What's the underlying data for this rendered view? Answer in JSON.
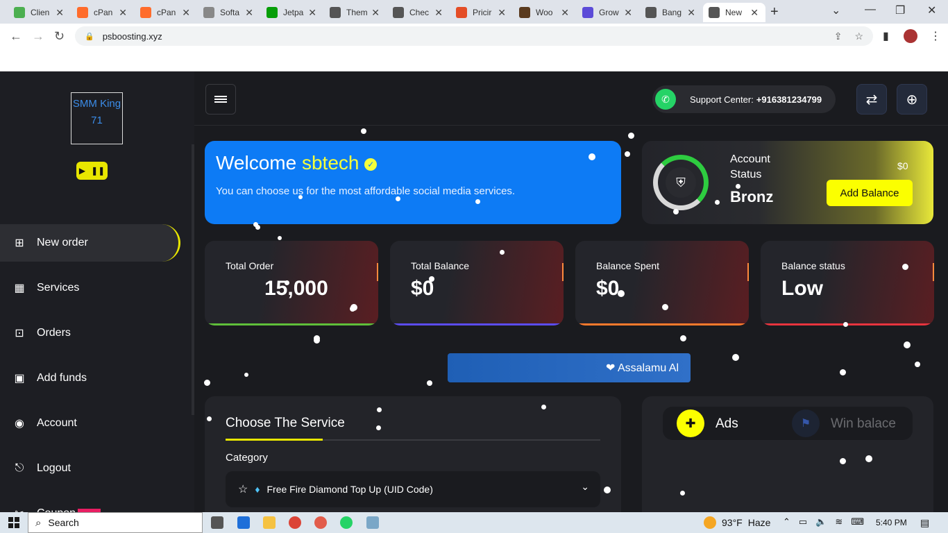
{
  "browser": {
    "tabs": [
      {
        "label": "Clien",
        "icon": "cpanel-client-icon",
        "color": "#4caf50"
      },
      {
        "label": "cPan",
        "icon": "cpanel-icon",
        "color": "#ff6c2c"
      },
      {
        "label": "cPan",
        "icon": "cpanel-icon",
        "color": "#ff6c2c"
      },
      {
        "label": "Softa",
        "icon": "softaculous-icon",
        "color": "#888888"
      },
      {
        "label": "Jetpa",
        "icon": "jetpack-icon",
        "color": "#069e08"
      },
      {
        "label": "Them",
        "icon": "globe-icon",
        "color": "#555555"
      },
      {
        "label": "Chec",
        "icon": "globe-icon",
        "color": "#555555"
      },
      {
        "label": "Pricir",
        "icon": "pricing-icon",
        "color": "#e44d26"
      },
      {
        "label": "Woo",
        "icon": "woo-icon",
        "color": "#5a3a1e"
      },
      {
        "label": "Grow",
        "icon": "grow-icon",
        "color": "#5c4bd8"
      },
      {
        "label": "Bang",
        "icon": "globe-icon",
        "color": "#555555"
      },
      {
        "label": "New",
        "icon": "globe-icon",
        "color": "#555555"
      }
    ],
    "url": "psboosting.xyz"
  },
  "sidebar": {
    "logo_alt": "SMM King 71",
    "items": [
      {
        "label": "New order",
        "icon": "plus-square-icon"
      },
      {
        "label": "Services",
        "icon": "grid-icon"
      },
      {
        "label": "Orders",
        "icon": "bag-icon"
      },
      {
        "label": "Add funds",
        "icon": "wallet-icon"
      },
      {
        "label": "Account",
        "icon": "user-circle-icon"
      },
      {
        "label": "Logout",
        "icon": "logout-icon"
      },
      {
        "label": "Coupon",
        "icon": "coupon-icon"
      }
    ]
  },
  "topbar": {
    "support_label": "Support Center:",
    "support_phone": "+916381234799"
  },
  "welcome": {
    "greeting": "Welcome",
    "username": "sbtech",
    "subtitle": "You can choose us for the most affordable social media services."
  },
  "account": {
    "label": "Account Status",
    "level": "Bronz",
    "add_balance": "Add Balance",
    "tag": "$0"
  },
  "stats": [
    {
      "label": "Total Order",
      "value": "15,000",
      "bar_color": "#5fbf3a"
    },
    {
      "label": "Total Balance",
      "value": "$0",
      "bar_color": "#5b4cf0"
    },
    {
      "label": "Balance Spent",
      "value": "$0",
      "bar_color": "#ff7a2c"
    },
    {
      "label": "Balance status",
      "value": "Low",
      "bar_color": "#e8343e"
    }
  ],
  "marquee": "❤ Assalamu Al",
  "service": {
    "tab": "Choose The Service",
    "category_label": "Category",
    "selected_category": "Free Fire Diamond Top Up (UID Code)"
  },
  "ads": {
    "tab_ads": "Ads",
    "tab_win": "Win balace"
  },
  "taskbar": {
    "search": "Search",
    "temperature": "93°F",
    "weather": "Haze",
    "time": "5:40 PM"
  }
}
